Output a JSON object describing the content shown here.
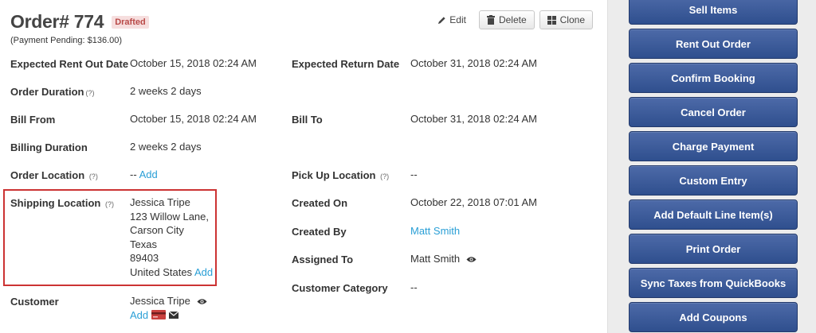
{
  "header": {
    "title": "Order# 774",
    "status": "Drafted",
    "payment_pending": "(Payment Pending: $136.00)"
  },
  "actions": {
    "edit": "Edit",
    "delete": "Delete",
    "clone": "Clone"
  },
  "fields": {
    "expected_rent_out": {
      "label": "Expected Rent Out Date",
      "value": "October 15, 2018 02:24 AM"
    },
    "expected_return": {
      "label": "Expected Return Date",
      "value": "October 31, 2018 02:24 AM"
    },
    "order_duration": {
      "label": "Order Duration",
      "help": "(?)",
      "value": "2 weeks 2 days"
    },
    "bill_from": {
      "label": "Bill From",
      "value": "October 15, 2018 02:24 AM"
    },
    "bill_to": {
      "label": "Bill To",
      "value": "October 31, 2018 02:24 AM"
    },
    "billing_duration": {
      "label": "Billing Duration",
      "value": "2 weeks 2 days"
    },
    "order_location": {
      "label": "Order Location",
      "help": "(?)",
      "value": "--",
      "add": "Add"
    },
    "pickup_location": {
      "label": "Pick Up Location",
      "help": "(?)",
      "value": "--"
    },
    "shipping_location": {
      "label": "Shipping Location",
      "help": "(?)",
      "name": "Jessica Tripe",
      "street": "123 Willow Lane,",
      "city": "Carson City",
      "state": "Texas",
      "zip": "89403",
      "country": "United States",
      "add": "Add"
    },
    "created_on": {
      "label": "Created On",
      "value": "October 22, 2018 07:01 AM"
    },
    "created_by": {
      "label": "Created By",
      "value": "Matt Smith"
    },
    "assigned_to": {
      "label": "Assigned To",
      "value": "Matt Smith"
    },
    "customer_category": {
      "label": "Customer Category",
      "value": "--"
    },
    "customer": {
      "label": "Customer",
      "value": "Jessica Tripe",
      "add": "Add"
    }
  },
  "sidebar": {
    "buttons": [
      {
        "label": "Sell Items"
      },
      {
        "label": "Rent Out Order"
      },
      {
        "label": "Confirm Booking"
      },
      {
        "label": "Cancel Order"
      },
      {
        "label": "Charge Payment"
      },
      {
        "label": "Custom Entry"
      },
      {
        "label": "Add Default Line Item(s)"
      },
      {
        "label": "Print Order"
      },
      {
        "label": "Sync Taxes from QuickBooks"
      },
      {
        "label": "Add Coupons"
      }
    ]
  },
  "colors": {
    "link": "#2a9fd6",
    "primary_button": "#3b5998",
    "highlight": "#cc3333",
    "status_badge_text": "#b94a48"
  },
  "icons": [
    "pencil-icon",
    "trash-icon",
    "grid-icon",
    "eye-icon",
    "credit-card-icon",
    "envelope-icon"
  ]
}
